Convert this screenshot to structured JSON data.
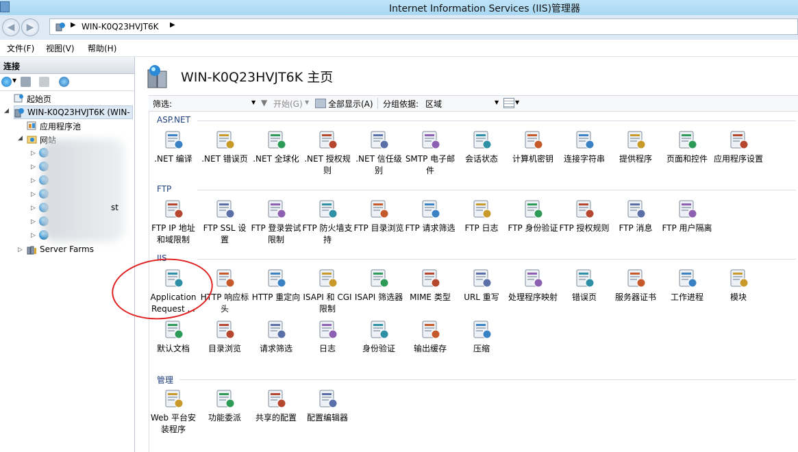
{
  "window": {
    "title": "Internet Information Services (IIS)管理器"
  },
  "address": {
    "path": "WIN-K0Q23HVJT6K"
  },
  "menu": [
    "文件(F)",
    "视图(V)",
    "帮助(H)"
  ],
  "connections": {
    "header": "连接",
    "tree": {
      "start_page": "起始页",
      "server": "WIN-K0Q23HVJT6K (WIN-",
      "app_pools": "应用程序池",
      "sites": "网站",
      "partial_site": "st",
      "server_farms": "Server Farms"
    }
  },
  "main": {
    "title": "WIN-K0Q23HVJT6K 主页",
    "filter": {
      "label": "筛选:",
      "start": "开始(G)",
      "show_all": "全部显示(A)",
      "group_by_label": "分组依据:",
      "group_by_value": "区域"
    },
    "groups": [
      {
        "name": "ASP.NET",
        "items": [
          {
            "label": ".NET 编译",
            "icon": "net-compile-icon"
          },
          {
            "label": ".NET 错误页",
            "icon": "error-page-404-icon"
          },
          {
            "label": ".NET 全球化",
            "icon": "globe-icon"
          },
          {
            "label": ".NET 授权规则",
            "icon": "lock-doc-icon"
          },
          {
            "label": ".NET 信任级别",
            "icon": "trust-check-icon"
          },
          {
            "label": "SMTP 电子邮件",
            "icon": "smtp-icon"
          },
          {
            "label": "会话状态",
            "icon": "session-icon"
          },
          {
            "label": "计算机密钥",
            "icon": "machine-key-icon"
          },
          {
            "label": "连接字符串",
            "icon": "connection-string-icon"
          },
          {
            "label": "提供程序",
            "icon": "providers-icon"
          },
          {
            "label": "页面和控件",
            "icon": "pages-controls-icon"
          },
          {
            "label": "应用程序设置",
            "icon": "app-settings-icon"
          }
        ]
      },
      {
        "name": "FTP",
        "items": [
          {
            "label": "FTP IP 地址和域限制",
            "icon": "ftp-ip-icon"
          },
          {
            "label": "FTP SSL 设置",
            "icon": "ftp-ssl-icon"
          },
          {
            "label": "FTP 登录尝试限制",
            "icon": "ftp-logon-icon"
          },
          {
            "label": "FTP 防火墙支持",
            "icon": "ftp-firewall-icon"
          },
          {
            "label": "FTP 目录浏览",
            "icon": "ftp-dir-icon"
          },
          {
            "label": "FTP 请求筛选",
            "icon": "ftp-filter-icon"
          },
          {
            "label": "FTP 日志",
            "icon": "ftp-log-icon"
          },
          {
            "label": "FTP 身份验证",
            "icon": "ftp-auth-icon"
          },
          {
            "label": "FTP 授权规则",
            "icon": "ftp-authz-icon"
          },
          {
            "label": "FTP 消息",
            "icon": "ftp-message-icon"
          },
          {
            "label": "FTP 用户隔离",
            "icon": "ftp-isolation-icon"
          }
        ]
      },
      {
        "name": "IIS",
        "items": [
          {
            "label": "Application Request ...",
            "icon": "arr-icon"
          },
          {
            "label": "HTTP 响应标头",
            "icon": "http-headers-icon"
          },
          {
            "label": "HTTP 重定向",
            "icon": "http-redirect-icon"
          },
          {
            "label": "ISAPI 和 CGI 限制",
            "icon": "isapi-cgi-icon"
          },
          {
            "label": "ISAPI 筛选器",
            "icon": "isapi-filter-icon"
          },
          {
            "label": "MIME 类型",
            "icon": "mime-icon"
          },
          {
            "label": "URL 重写",
            "icon": "url-rewrite-icon"
          },
          {
            "label": "处理程序映射",
            "icon": "handler-mapping-icon"
          },
          {
            "label": "错误页",
            "icon": "error-page-icon"
          },
          {
            "label": "服务器证书",
            "icon": "server-cert-icon"
          },
          {
            "label": "工作进程",
            "icon": "worker-process-icon"
          },
          {
            "label": "模块",
            "icon": "modules-icon"
          },
          {
            "label": "默认文档",
            "icon": "default-doc-icon"
          },
          {
            "label": "目录浏览",
            "icon": "dir-browse-icon"
          },
          {
            "label": "请求筛选",
            "icon": "request-filter-icon"
          },
          {
            "label": "日志",
            "icon": "logging-icon"
          },
          {
            "label": "身份验证",
            "icon": "authentication-icon"
          },
          {
            "label": "输出缓存",
            "icon": "output-cache-icon"
          },
          {
            "label": "压缩",
            "icon": "compression-icon"
          }
        ]
      },
      {
        "name": "管理",
        "items": [
          {
            "label": "Web 平台安装程序",
            "icon": "web-platform-installer-icon"
          },
          {
            "label": "功能委派",
            "icon": "feature-delegation-icon"
          },
          {
            "label": "共享的配置",
            "icon": "shared-config-icon"
          },
          {
            "label": "配置编辑器",
            "icon": "config-editor-icon"
          }
        ]
      }
    ]
  }
}
